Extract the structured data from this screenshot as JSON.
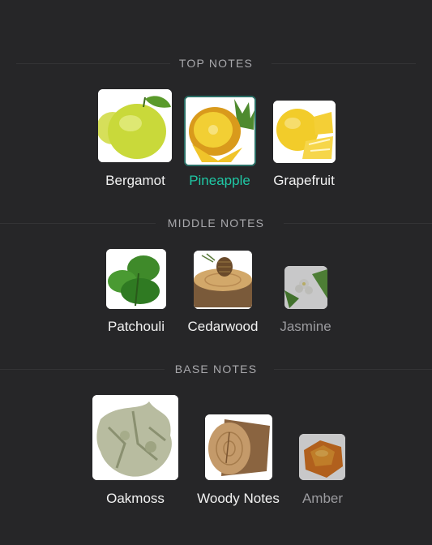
{
  "sections": [
    {
      "title": "TOP NOTES",
      "items": [
        {
          "label": "Bergamot",
          "icon": "bergamot-icon",
          "state": "normal"
        },
        {
          "label": "Pineapple",
          "icon": "pineapple-icon",
          "state": "selected"
        },
        {
          "label": "Grapefruit",
          "icon": "grapefruit-icon",
          "state": "normal"
        }
      ]
    },
    {
      "title": "MIDDLE NOTES",
      "items": [
        {
          "label": "Patchouli",
          "icon": "patchouli-icon",
          "state": "normal"
        },
        {
          "label": "Cedarwood",
          "icon": "cedarwood-icon",
          "state": "normal"
        },
        {
          "label": "Jasmine",
          "icon": "jasmine-icon",
          "state": "muted"
        }
      ]
    },
    {
      "title": "BASE NOTES",
      "items": [
        {
          "label": "Oakmoss",
          "icon": "oakmoss-icon",
          "state": "normal"
        },
        {
          "label": "Woody Notes",
          "icon": "woody-notes-icon",
          "state": "normal"
        },
        {
          "label": "Amber",
          "icon": "amber-icon",
          "state": "muted"
        }
      ]
    }
  ],
  "colors": {
    "background": "#262628",
    "accent": "#1fc8a5",
    "muted_text": "#9b9b9f",
    "header_text": "#a9a9ad"
  }
}
